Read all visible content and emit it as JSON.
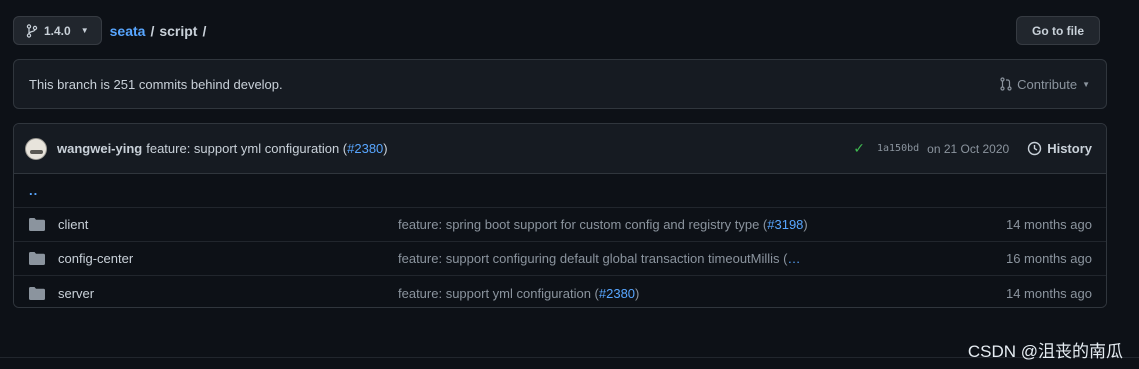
{
  "branch": {
    "label": "1.4.0"
  },
  "breadcrumb": {
    "repo": "seata",
    "sep1": "/",
    "dir": "script",
    "sep2": "/"
  },
  "goto_file": "Go to file",
  "notice": {
    "text": "This branch is 251 commits behind develop.",
    "contribute": "Contribute"
  },
  "latest_commit": {
    "author": "wangwei-ying",
    "message_prefix": "feature: support yml configuration (",
    "pr": "#2380",
    "message_suffix": ")",
    "sha": "1a150bd",
    "date": "on 21 Oct 2020",
    "history": "History"
  },
  "parent_link": "..",
  "files": [
    {
      "name": "client",
      "msg": "feature: spring boot support for custom config and registry type (",
      "pr": "#3198",
      "suffix": ")",
      "age": "14 months ago"
    },
    {
      "name": "config-center",
      "msg": "feature: support configuring default global transaction timeoutMillis (",
      "pr": "…",
      "suffix": "",
      "age": "16 months ago"
    },
    {
      "name": "server",
      "msg": "feature: support yml configuration (",
      "pr": "#2380",
      "suffix": ")",
      "age": "14 months ago"
    }
  ],
  "watermark": "CSDN @沮丧的南瓜",
  "colors": {
    "link": "#58a6ff",
    "success": "#3fb950",
    "bg": "#0d1117"
  }
}
